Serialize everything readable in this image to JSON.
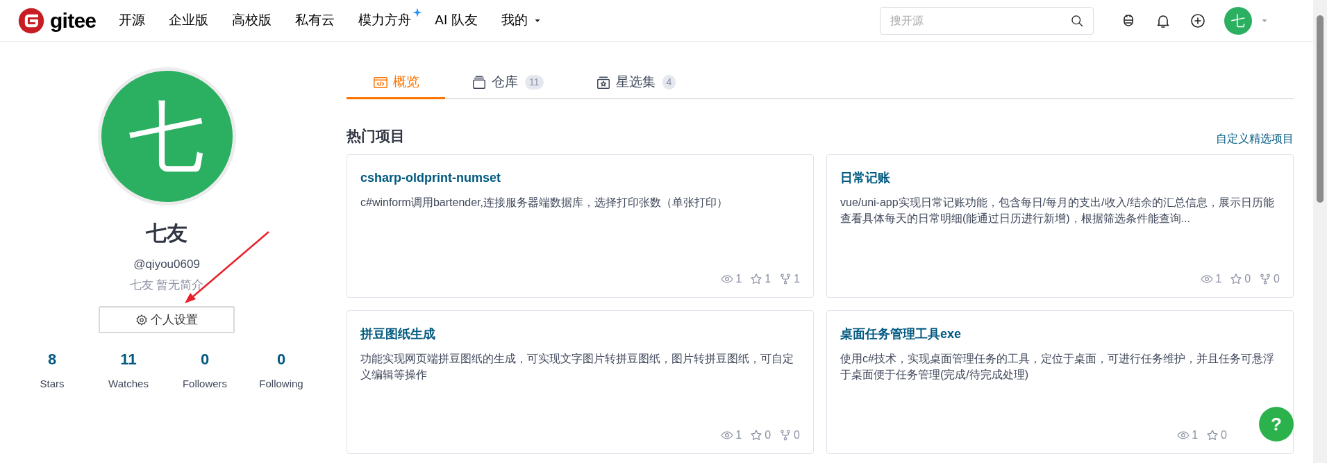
{
  "nav": {
    "logo": "gitee",
    "links": [
      {
        "label": "开源",
        "sparkle": false
      },
      {
        "label": "企业版",
        "sparkle": false
      },
      {
        "label": "高校版",
        "sparkle": false
      },
      {
        "label": "私有云",
        "sparkle": false
      },
      {
        "label": "模力方舟",
        "sparkle": true
      },
      {
        "label": "AI 队友",
        "sparkle": false
      }
    ],
    "menu": "我的",
    "search": {
      "placeholder": "搜开源"
    },
    "avatar": "七"
  },
  "profile": {
    "avatar": "七",
    "name": "七友",
    "username": "@qiyou0609",
    "bio": "七友 暂无简介",
    "settings_button": "个人设置",
    "stats": [
      {
        "value": "8",
        "label": "Stars"
      },
      {
        "value": "11",
        "label": "Watches"
      },
      {
        "value": "0",
        "label": "Followers"
      },
      {
        "value": "0",
        "label": "Following"
      }
    ]
  },
  "tabs": [
    {
      "kind": "overview",
      "label": "概览",
      "selected": true
    },
    {
      "kind": "repos",
      "label": "仓库",
      "count": "11",
      "selected": false
    },
    {
      "kind": "collections",
      "label": "星选集",
      "count": "4",
      "selected": false
    }
  ],
  "section": {
    "title": "热门项目",
    "link": "自定义精选项目"
  },
  "projects": [
    {
      "name": "csharp-oldprint-numset",
      "description": "c#winform调用bartender,连接服务器端数据库，选择打印张数（单张打印）",
      "views": "1",
      "stars": "1",
      "forks": "1"
    },
    {
      "name": "日常记账",
      "description": "vue/uni-app实现日常记账功能，包含每日/每月的支出/收入/结余的汇总信息，展示日历能查看具体每天的日常明细(能通过日历进行新增)，根据筛选条件能查询...",
      "views": "1",
      "stars": "0",
      "forks": "0"
    },
    {
      "name": "拼豆图纸生成",
      "description": "功能实现网页端拼豆图纸的生成，可实现文字图片转拼豆图纸，图片转拼豆图纸，可自定义编辑等操作",
      "views": "1",
      "stars": "0",
      "forks": "0"
    },
    {
      "name": "桌面任务管理工具exe",
      "description": "使用c#技术，实现桌面管理任务的工具，定位于桌面，可进行任务维护，并且任务可悬浮于桌面便于任务管理(完成/待完成处理)",
      "views": "1",
      "stars": "0"
    }
  ],
  "help_button": "?"
}
